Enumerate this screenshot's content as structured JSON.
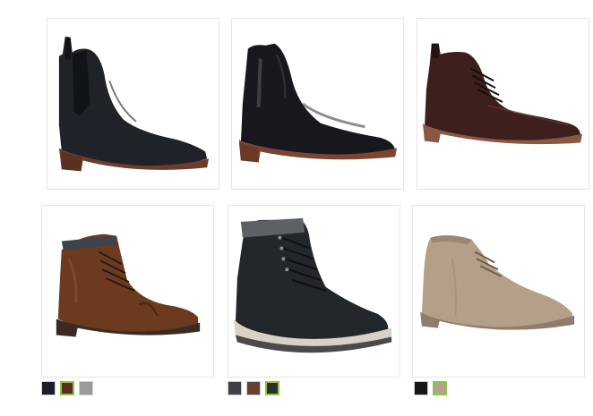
{
  "products": [
    {
      "name": "black-chelsea-boot",
      "icon": "chelsea-boot-icon",
      "color": "#1f2229",
      "sole": "#6b3d2a"
    },
    {
      "name": "black-side-zip-boot",
      "icon": "side-zip-boot-icon",
      "color": "#16181d",
      "sole": "#7a4631"
    },
    {
      "name": "brown-chukka-boot",
      "icon": "chukka-boot-icon",
      "color": "#3d1f1d",
      "sole": "#8a5840"
    },
    {
      "name": "brown-cap-toe-boot",
      "icon": "lace-up-boot-icon",
      "color": "#6b3a1f",
      "sole": "#3a2a22",
      "swatches": [
        {
          "color": "#1b1e28",
          "selected": false
        },
        {
          "color": "#5a2e22",
          "selected": true
        },
        {
          "color": "#9b9b9b",
          "selected": false
        }
      ]
    },
    {
      "name": "black-work-boot",
      "icon": "work-boot-icon",
      "color": "#23262b",
      "sole": "#d8d2c4",
      "swatches": [
        {
          "color": "#3e4147",
          "selected": false
        },
        {
          "color": "#6a3f33",
          "selected": false
        },
        {
          "color": "#2b2f30",
          "selected": true
        }
      ]
    },
    {
      "name": "tan-suede-chukka",
      "icon": "suede-chukka-icon",
      "color": "#b49f88",
      "sole": "#8e7d6c",
      "swatches": [
        {
          "color": "#15171a",
          "selected": false
        },
        {
          "color": "#b29f8d",
          "selected": true
        }
      ]
    }
  ]
}
